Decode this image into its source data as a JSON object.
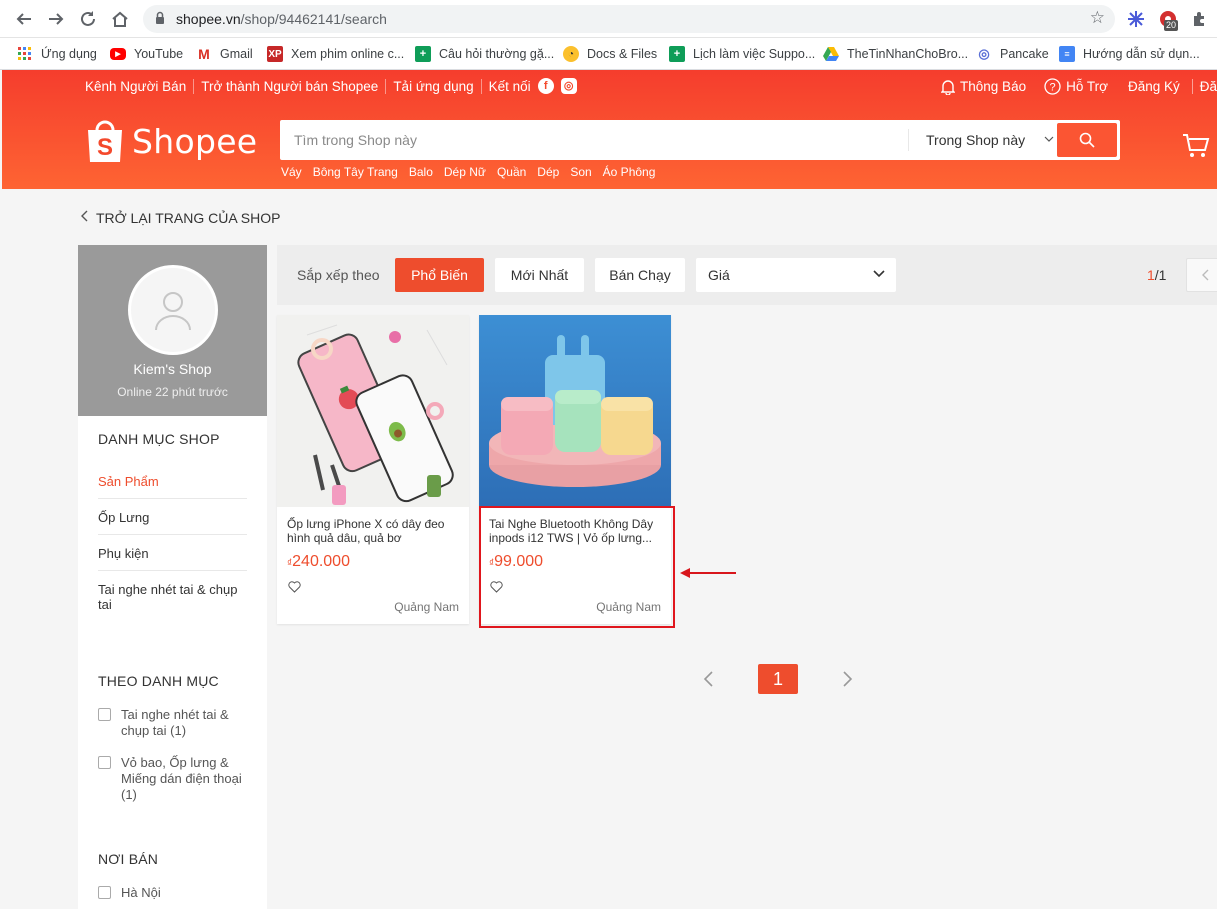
{
  "browser": {
    "url_host": "shopee.vn",
    "url_path": "/shop/94462141/search",
    "ext_badge": "20"
  },
  "bookmarks": [
    {
      "label": "Ứng dụng",
      "icon": "apps-grid-icon"
    },
    {
      "label": "YouTube",
      "icon": "youtube-icon"
    },
    {
      "label": "Gmail",
      "icon": "gmail-icon"
    },
    {
      "label": "Xem phim online c...",
      "icon": "xp-icon"
    },
    {
      "label": "Câu hỏi thường gặ...",
      "icon": "sheets-icon"
    },
    {
      "label": "Docs & Files",
      "icon": "docs-files-icon"
    },
    {
      "label": "Lịch làm việc Suppo...",
      "icon": "sheets-icon"
    },
    {
      "label": "TheTinNhanChoBro...",
      "icon": "drive-icon"
    },
    {
      "label": "Pancake",
      "icon": "pancake-icon"
    },
    {
      "label": "Hướng dẫn sử dụn...",
      "icon": "google-docs-icon"
    }
  ],
  "header": {
    "top_links": [
      "Kênh Người Bán",
      "Trở thành Người bán Shopee",
      "Tải ứng dụng",
      "Kết nối"
    ],
    "notifications": "Thông Báo",
    "support": "Hỗ Trợ",
    "register": "Đăng Ký",
    "cut_link": "Đă",
    "logo_text": "Shopee",
    "search_placeholder": "Tìm trong Shop này",
    "search_scope": "Trong Shop này",
    "keywords": [
      "Váy",
      "Bông Tây Trang",
      "Balo",
      "Dép Nữ",
      "Quần",
      "Dép",
      "Son",
      "Áo Phông"
    ]
  },
  "back_link": "TRỞ LẠI TRANG CỦA SHOP",
  "shop": {
    "name": "Kiem's Shop",
    "online": "Online 22 phút trước"
  },
  "sidebar": {
    "shop_categories_title": "DANH MỤC SHOP",
    "shop_categories": [
      "Sản Phẩm",
      "Ốp Lưng",
      "Phụ kiện",
      "Tai nghe nhét tai & chụp tai"
    ],
    "by_category_title": "THEO DANH MỤC",
    "by_category": [
      "Tai nghe nhét tai & chụp tai (1)",
      "Vỏ bao, Ốp lưng & Miếng dán điện thoại (1)"
    ],
    "location_title": "NƠI BÁN",
    "locations": [
      "Hà Nội"
    ]
  },
  "sort": {
    "label": "Sắp xếp theo",
    "popular": "Phổ Biến",
    "newest": "Mới Nhất",
    "best_selling": "Bán Chạy",
    "price": "Giá",
    "page_current": "1",
    "page_sep_total": "/1"
  },
  "products": [
    {
      "name": "Ốp lưng iPhone X có dây đeo hình quả dâu, quả bơ",
      "currency": "₫",
      "price": "240.000",
      "location": "Quảng Nam"
    },
    {
      "name": "Tai Nghe Bluetooth Không Dây inpods i12 TWS | Vỏ ốp lưng...",
      "currency": "₫",
      "price": "99.000",
      "location": "Quảng Nam"
    }
  ],
  "pagination": {
    "current": "1"
  },
  "colors": {
    "brand": "#ee4d2d",
    "highlight": "#e0161d"
  }
}
